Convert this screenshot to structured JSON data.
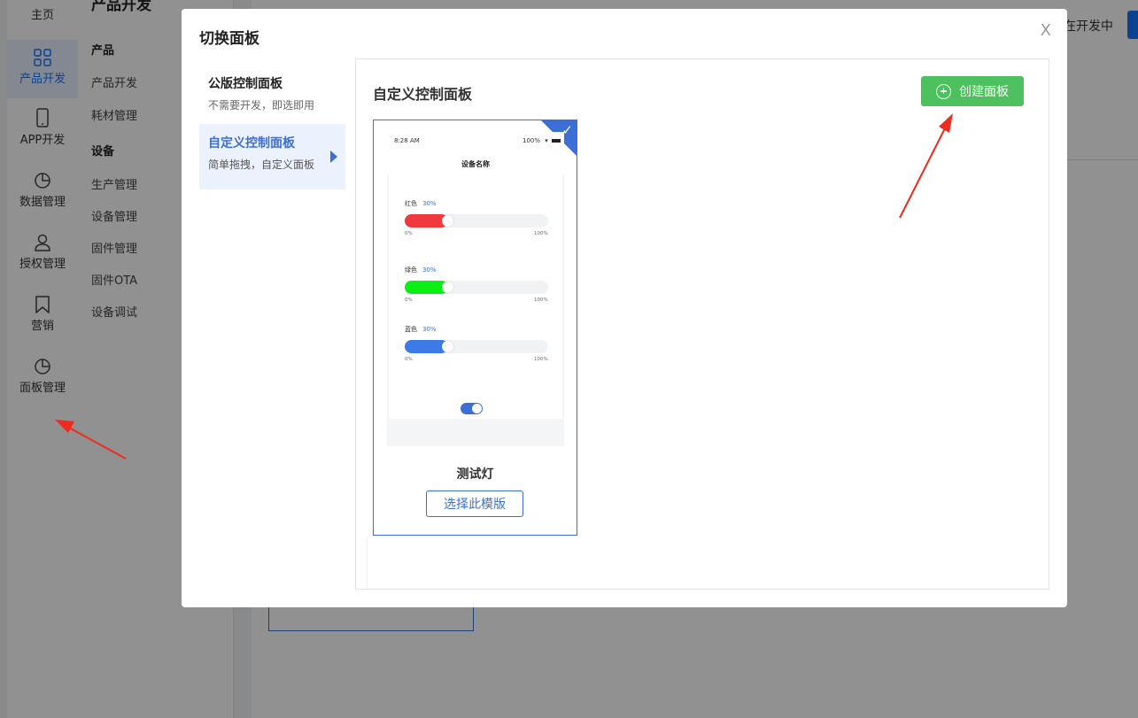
{
  "nav": {
    "items": [
      {
        "label": "主页",
        "icon": "home-icon"
      },
      {
        "label": "产品开发",
        "icon": "grid-icon"
      },
      {
        "label": "APP开发",
        "icon": "phone-icon"
      },
      {
        "label": "数据管理",
        "icon": "pie-chart-icon"
      },
      {
        "label": "授权管理",
        "icon": "user-icon"
      },
      {
        "label": "营销",
        "icon": "bookmark-icon"
      },
      {
        "label": "面板管理",
        "icon": "pie-chart-icon"
      }
    ],
    "active": "产品开发",
    "accent_color": "#1677ff"
  },
  "subnav": {
    "title": "产品开发",
    "group1": "产品",
    "group1_items": [
      "产品开发",
      "耗材管理"
    ],
    "group2": "设备",
    "group2_items": [
      "生产管理",
      "设备管理",
      "固件管理",
      "固件OTA",
      "设备调试"
    ]
  },
  "header": {
    "status_text": "在开发中"
  },
  "modal": {
    "title": "切换面板",
    "close_label": "X",
    "tabs": [
      {
        "title": "公版控制面板",
        "desc": "不需要开发，即选即用"
      },
      {
        "title": "自定义控制面板",
        "desc": "简单拖拽，自定义面板"
      }
    ],
    "active_tab": "自定义控制面板",
    "content_title": "自定义控制面板",
    "create_button": "创建面板",
    "create_button_color": "#4cc15d",
    "template": {
      "name": "测试灯",
      "select_button": "选择此模版",
      "selected": true,
      "preview": {
        "time": "8:28 AM",
        "battery": "100%",
        "device_title": "设备名称",
        "controls": [
          {
            "label": "红色",
            "value": "30%",
            "min": "0%",
            "max": "100%",
            "color": "#f0383f",
            "level": 0.3
          },
          {
            "label": "绿色",
            "value": "30%",
            "min": "0%",
            "max": "100%",
            "color": "#0cef14",
            "level": 0.3
          },
          {
            "label": "蓝色",
            "value": "30%",
            "min": "0%",
            "max": "100%",
            "color": "#3b7be8",
            "level": 0.3
          }
        ],
        "switch_on": true
      }
    }
  }
}
